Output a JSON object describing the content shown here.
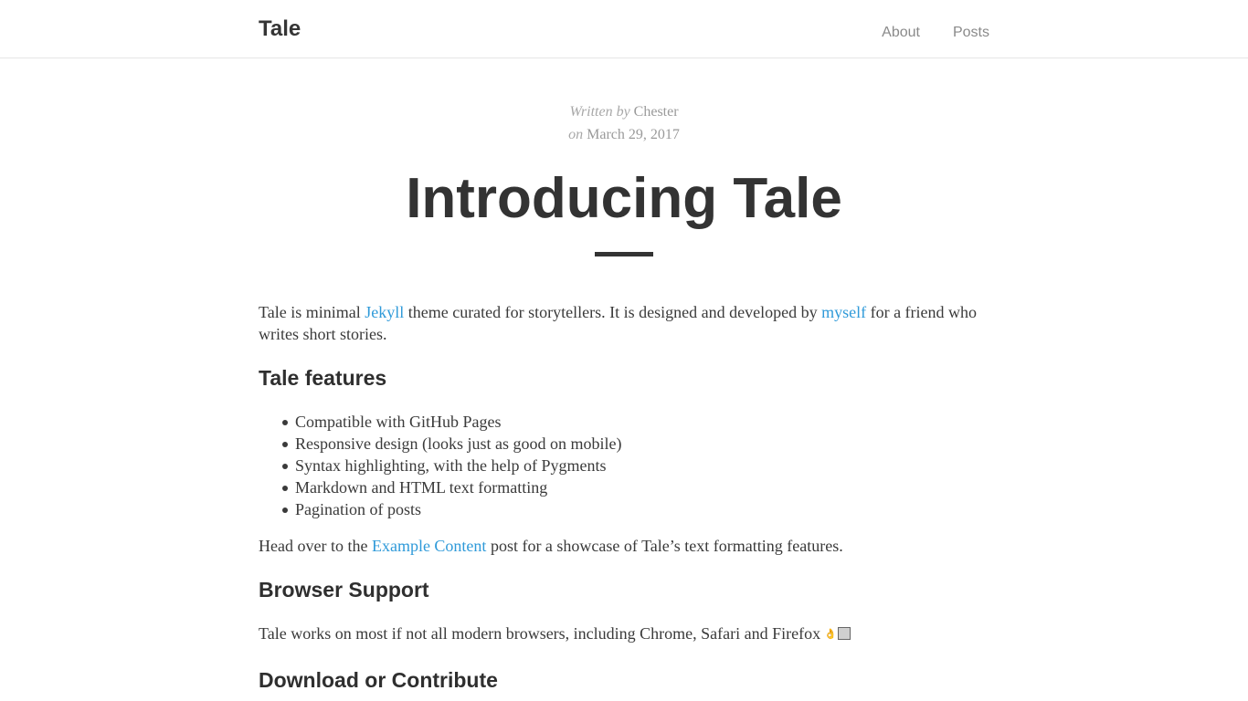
{
  "header": {
    "brand": "Tale",
    "links": [
      {
        "label": "About"
      },
      {
        "label": "Posts"
      }
    ]
  },
  "post": {
    "written_label": "Written",
    "by_label": "by",
    "author": "Chester",
    "on_label": "on",
    "date": "March 29, 2017",
    "title": "Introducing Tale",
    "intro": {
      "text_1": "Tale is minimal ",
      "link_1": "Jekyll",
      "text_2": " theme curated for storytellers. It is designed and developed by ",
      "link_2": "myself",
      "text_3": " for a friend who writes short stories."
    },
    "features_heading": "Tale features",
    "features": [
      "Compatible with GitHub Pages",
      "Responsive design (looks just as good on mobile)",
      "Syntax highlighting, with the help of Pygments",
      "Markdown and HTML text formatting",
      "Pagination of posts"
    ],
    "head_over": {
      "text_1": "Head over to the ",
      "link": "Example Content",
      "text_2": " post for a showcase of Tale’s text formatting features."
    },
    "browser_heading": "Browser Support",
    "browser_text": "Tale works on most if not all modern browsers, including Chrome, Safari and Firefox",
    "emoji_hand": "👌",
    "download_heading": "Download or Contribute"
  }
}
